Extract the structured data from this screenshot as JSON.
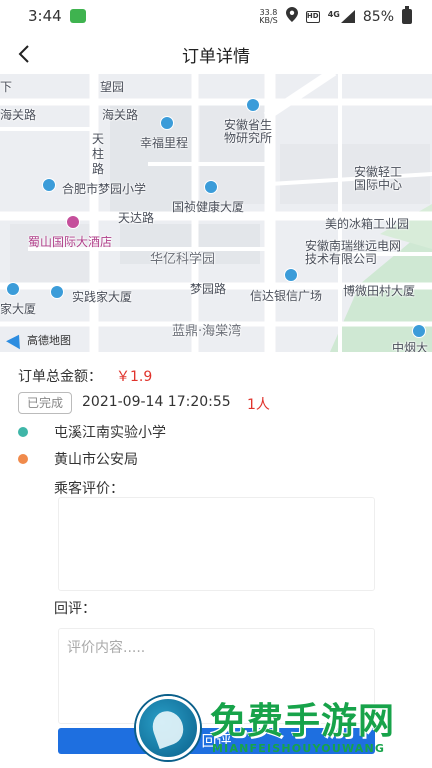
{
  "status_bar": {
    "time": "3:44",
    "net_speed_value": "33.8",
    "net_speed_unit": "KB/S",
    "hd_label": "HD",
    "signal_label": "4G",
    "battery": "85%"
  },
  "nav": {
    "back_icon": "chevron-left-icon",
    "title": "订单详情"
  },
  "map": {
    "labels": [
      "下",
      "望园",
      "海关路",
      "海关路",
      "天柱路",
      "幸福里程",
      "安徽省生物研究所",
      "安徽轻工国际中心",
      "合肥市梦园小学",
      "国祯健康大厦",
      "天达路",
      "美的冰箱工业园",
      "蜀山国际大酒店",
      "华亿科学园",
      "安徽南瑞继远电网技术有限公司",
      "梦园路",
      "信达银信广场",
      "博微田村大厦",
      "家大厦",
      "实践家大厦",
      "蓝鼎·海棠湾",
      "中烟大",
      "高德地图"
    ]
  },
  "order": {
    "total_label": "订单总金额：",
    "total_amount": "￥1.9",
    "status": "已完成",
    "datetime": "2021-09-14 17:20:55",
    "passengers": "1人",
    "start": "屯溪江南实验小学",
    "end": "黄山市公安局",
    "start_color": "#3fb6a8",
    "end_color": "#f08a4b"
  },
  "feedback": {
    "passenger_label": "乘客评价：",
    "passenger_review": "",
    "reply_label": "回评：",
    "reply_placeholder": "评价内容.....",
    "submit_label": "回评"
  },
  "watermark": {
    "cn": "免费手游网",
    "en": "MIANFEISHOUYOUWANG"
  },
  "colors": {
    "accent": "#1e6fe0",
    "price": "#e0332c"
  }
}
